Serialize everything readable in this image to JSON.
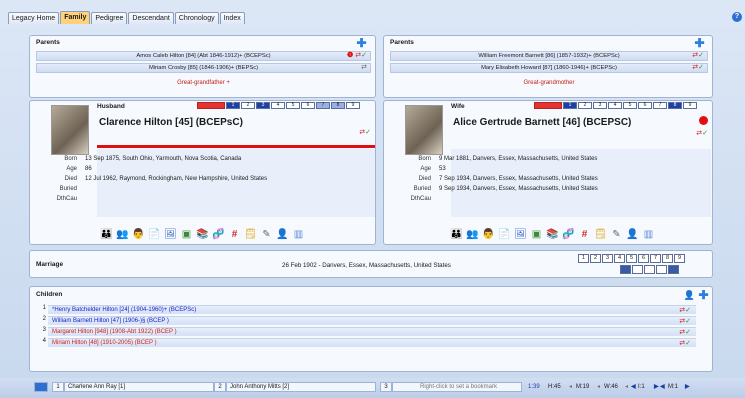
{
  "tabs": [
    "Legacy Home",
    "Family",
    "Pedigree",
    "Descendant",
    "Chronology",
    "Index"
  ],
  "parents_left": {
    "title": "Parents",
    "father": "Amos Caleb Hilton [84] (Abt 1846-1912)+ (BCEPSc)",
    "mother": "Miriam Crosby [85] (1846-1906)+ (BEPSc)",
    "ggp": "Great-grandfather +"
  },
  "parents_right": {
    "title": "Parents",
    "father": "William Freemont Barnett [86] (1857-1932)+ (BCEPSc)",
    "mother": "Mary Elisabeth Howard [87] (1860-1946)+ (BCEPSc)",
    "ggp": "Great-grandmother"
  },
  "husband": {
    "role": "Husband",
    "name": "Clarence Hilton [45] (BCEPsC)",
    "facts": [
      {
        "label": "Born",
        "value": "13 Sep 1875, South Ohio, Yarmouth, Nova Scotia, Canada"
      },
      {
        "label": "Age",
        "value": "86"
      },
      {
        "label": "Died",
        "value": "12 Jul 1962, Raymond, Rockingham, New Hampshire, United States"
      },
      {
        "label": "Buried",
        "value": ""
      },
      {
        "label": "DthCau",
        "value": ""
      }
    ],
    "nums": [
      "1",
      "2",
      "3",
      "4",
      "5",
      "6",
      "7",
      "8",
      "9"
    ]
  },
  "wife": {
    "role": "Wife",
    "name": "Alice Gertrude Barnett [46] (BCEPSC)",
    "facts": [
      {
        "label": "Born",
        "value": "9 Mar 1881, Danvers, Essex, Massachusetts, United States"
      },
      {
        "label": "Age",
        "value": "53"
      },
      {
        "label": "Died",
        "value": "7 Sep 1934, Danvers, Essex, Massachusetts, United States"
      },
      {
        "label": "Buried",
        "value": "9 Sep 1934, Danvers, Essex, Massachusetts, United States"
      },
      {
        "label": "DthCau",
        "value": ""
      }
    ],
    "nums": [
      "1",
      "2",
      "3",
      "4",
      "5",
      "6",
      "7",
      "8",
      "9"
    ]
  },
  "marriage": {
    "label": "Marriage",
    "value": "26 Feb 1902 - Danvers, Essex, Massachusetts, United States",
    "nums": [
      "1",
      "2",
      "3",
      "4",
      "5",
      "6",
      "7",
      "8",
      "9"
    ]
  },
  "children": {
    "title": "Children",
    "items": [
      {
        "num": "1",
        "text": "*Henry Batchelder Hilton [24] (1904-1960)+ (BCEPSc)",
        "color": "#1a23c8"
      },
      {
        "num": "2",
        "text": "William Barnett Hilton [47] (1906-)§ (BCEP )",
        "color": "#1a23c8"
      },
      {
        "num": "3",
        "text": "Margaret Hilton [948] (1908-Abt 1922) (BCEP )",
        "color": "#d0201a"
      },
      {
        "num": "4",
        "text": "Miriam Hilton [48] (1910-2005) (BCEP )",
        "color": "#d0201a"
      }
    ]
  },
  "statusbar": {
    "b1num": "1",
    "b1": "Charlene Ann Ray [1]",
    "b2num": "2",
    "b2": "John Anthony Mitts [2]",
    "b3num": "3",
    "b3": "Right-click to set a bookmark",
    "time": "1:39",
    "h": "H:45",
    "m": "M:19",
    "w": "W:46",
    "i": "I:1",
    "m2": "M:1"
  },
  "colors": {
    "red": "#e01010",
    "blue": "#1f3fa8",
    "accent": "#ffd27a"
  }
}
